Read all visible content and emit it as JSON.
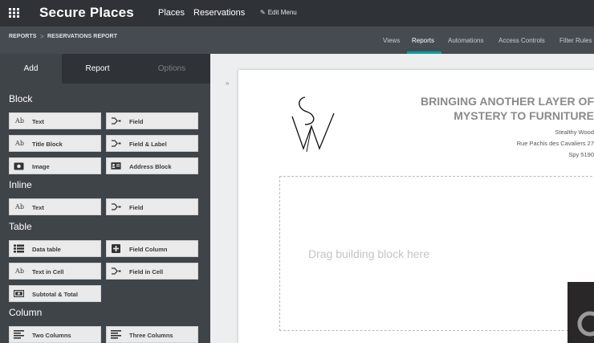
{
  "topbar": {
    "app_title": "Secure Places",
    "nav": [
      "Places",
      "Reservations"
    ],
    "edit_menu": "Edit Menu"
  },
  "breadcrumb": {
    "parent": "REPORTS",
    "separator": ">",
    "current": "RESERVATIONS REPORT"
  },
  "view_tabs": [
    "Views",
    "Reports",
    "Automations",
    "Access Controls",
    "Filter Rules"
  ],
  "active_view_tab": "Reports",
  "sidebar": {
    "tabs": [
      "Add",
      "Report",
      "Options"
    ],
    "active_tab": "Add",
    "sections": {
      "block": {
        "title": "Block",
        "items": [
          {
            "label": "Text",
            "icon": "Ab"
          },
          {
            "label": "Field",
            "icon": "field-icon"
          },
          {
            "label": "Title Block",
            "icon": "Ab"
          },
          {
            "label": "Field & Label",
            "icon": "field-icon"
          },
          {
            "label": "Image",
            "icon": "camera-icon"
          },
          {
            "label": "Address Block",
            "icon": "address-card-icon"
          }
        ]
      },
      "inline": {
        "title": "Inline",
        "items": [
          {
            "label": "Text",
            "icon": "Ab"
          },
          {
            "label": "Field",
            "icon": "field-icon"
          }
        ]
      },
      "table": {
        "title": "Table",
        "items": [
          {
            "label": "Data table",
            "icon": "table-list-icon"
          },
          {
            "label": "Field Column",
            "icon": "plus-square-icon"
          },
          {
            "label": "Text in Cell",
            "icon": "Ab"
          },
          {
            "label": "Field in Cell",
            "icon": "field-icon"
          },
          {
            "label": "Subtotal & Total",
            "icon": "money-icon"
          }
        ]
      },
      "column": {
        "title": "Column",
        "items": [
          {
            "label": "Two Columns",
            "icon": "align-left-icon"
          },
          {
            "label": "Three Columns",
            "icon": "align-left-icon"
          }
        ]
      }
    }
  },
  "document": {
    "heading_line1": "BRINGING ANOTHER LAYER OF",
    "heading_line2": "MYSTERY TO FURNITURE",
    "address_name": "Stealthy Wood",
    "address_street": "Rue Pachis des Cavaliers 27",
    "address_city": "Spy 5190",
    "drop_zone_text": "Drag building block here",
    "logo": "SW monogram"
  },
  "colors": {
    "topbar": "#2f3338",
    "subbar": "#464b51",
    "sidebar": "#3f4449",
    "accent": "#00a09d",
    "block_bg": "#eaeaea",
    "heading_grey": "#8a8a8a"
  }
}
